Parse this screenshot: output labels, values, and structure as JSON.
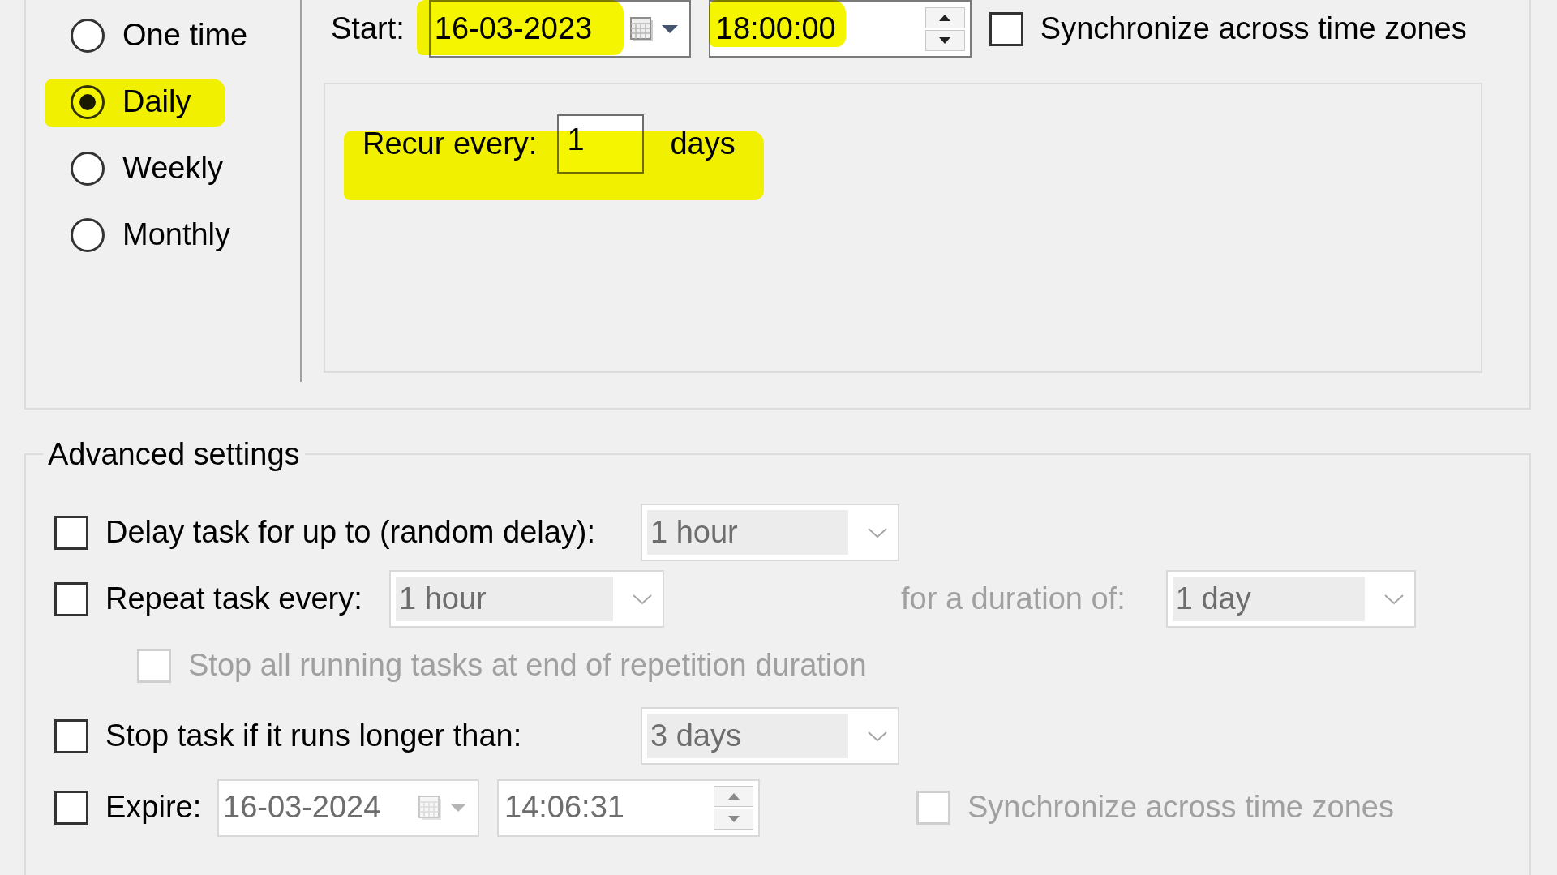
{
  "schedule_types": [
    {
      "label": "One time",
      "selected": false,
      "highlighted": false
    },
    {
      "label": "Daily",
      "selected": true,
      "highlighted": true
    },
    {
      "label": "Weekly",
      "selected": false,
      "highlighted": false
    },
    {
      "label": "Monthly",
      "selected": false,
      "highlighted": false
    }
  ],
  "start": {
    "label": "Start:",
    "date": {
      "value": "16-03-2023",
      "highlighted": true
    },
    "time": {
      "value": "18:00:00",
      "highlighted": true
    },
    "sync": {
      "label": "Synchronize across time zones",
      "checked": false
    }
  },
  "recur": {
    "label": "Recur every:",
    "value": "1",
    "unit": "days",
    "highlighted": true
  },
  "advanced_settings": {
    "title": "Advanced settings",
    "delay": {
      "label": "Delay task for up to (random delay):",
      "checked": false,
      "dropdown": {
        "value": "1 hour",
        "disabled": true
      }
    },
    "repeat": {
      "label": "Repeat task every:",
      "checked": false,
      "interval": {
        "value": "1 hour",
        "disabled": true
      },
      "duration": {
        "label": "for a duration of:",
        "value": "1 day",
        "disabled": true
      },
      "stop_all": {
        "label": "Stop all running tasks at end of repetition duration",
        "checked": false,
        "disabled": true
      }
    },
    "stop_task": {
      "label": "Stop task if it runs longer than:",
      "checked": false,
      "dropdown": {
        "value": "3 days",
        "disabled": true
      }
    },
    "expire": {
      "label": "Expire:",
      "checked": false,
      "date": {
        "value": "16-03-2024",
        "disabled": true
      },
      "time": {
        "value": "14:06:31",
        "disabled": true
      },
      "sync": {
        "label": "Synchronize across time zones",
        "checked": false,
        "disabled": true
      }
    }
  }
}
